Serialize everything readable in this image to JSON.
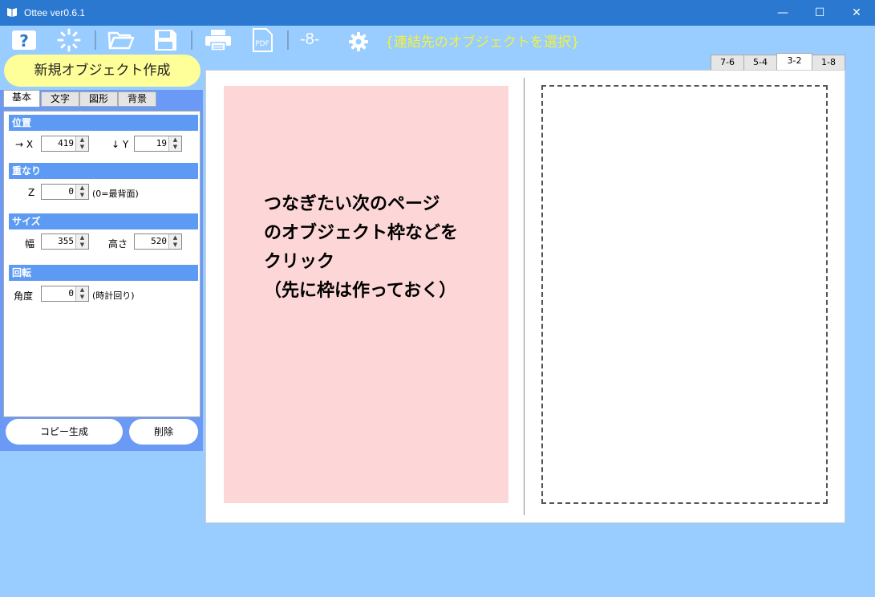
{
  "window": {
    "title": "Ottee ver0.6.1",
    "minimize": "—",
    "maximize": "☐",
    "close": "✕"
  },
  "toolbar": {
    "page_counter": "-8-",
    "status": "{連結先のオブジェクトを選択}",
    "icons": [
      "help-icon",
      "loading-icon",
      "open-folder-icon",
      "save-icon",
      "print-icon",
      "pdf-icon",
      "gear-icon"
    ],
    "pdf_label": "PDF"
  },
  "new_object_button": "新規オブジェクト作成",
  "panel": {
    "tabs": [
      "基本",
      "文字",
      "図形",
      "背景"
    ],
    "sections": {
      "position": {
        "header": "位置",
        "x_label": "→ X",
        "x_value": "419",
        "y_label": "↓ Y",
        "y_value": "19"
      },
      "layer": {
        "header": "重なり",
        "z_label": "Z",
        "z_value": "0",
        "z_note": "(0=最背面)"
      },
      "size": {
        "header": "サイズ",
        "width_label": "幅",
        "width_value": "355",
        "height_label": "高さ",
        "height_value": "520"
      },
      "rotation": {
        "header": "回転",
        "angle_label": "角度",
        "angle_value": "0",
        "angle_note": "(時計回り)"
      }
    },
    "copy_button": "コピー生成",
    "delete_button": "削除"
  },
  "page_tabs": [
    "7-6",
    "5-4",
    "3-2",
    "1-8"
  ],
  "active_page_tab": "3-2",
  "canvas": {
    "left_frame_text": "つなぎたい次のページ\nのオブジェクト枠などを\nクリック\n（先に枠は作っておく）"
  },
  "colors": {
    "titlebar": "#2b78d1",
    "background": "#99ccff",
    "panel": "#6a9af5",
    "section_header": "#5d9af3",
    "new_button": "#ffff99",
    "status_text": "#f2f23c",
    "pink_frame": "#fdd7d7"
  }
}
